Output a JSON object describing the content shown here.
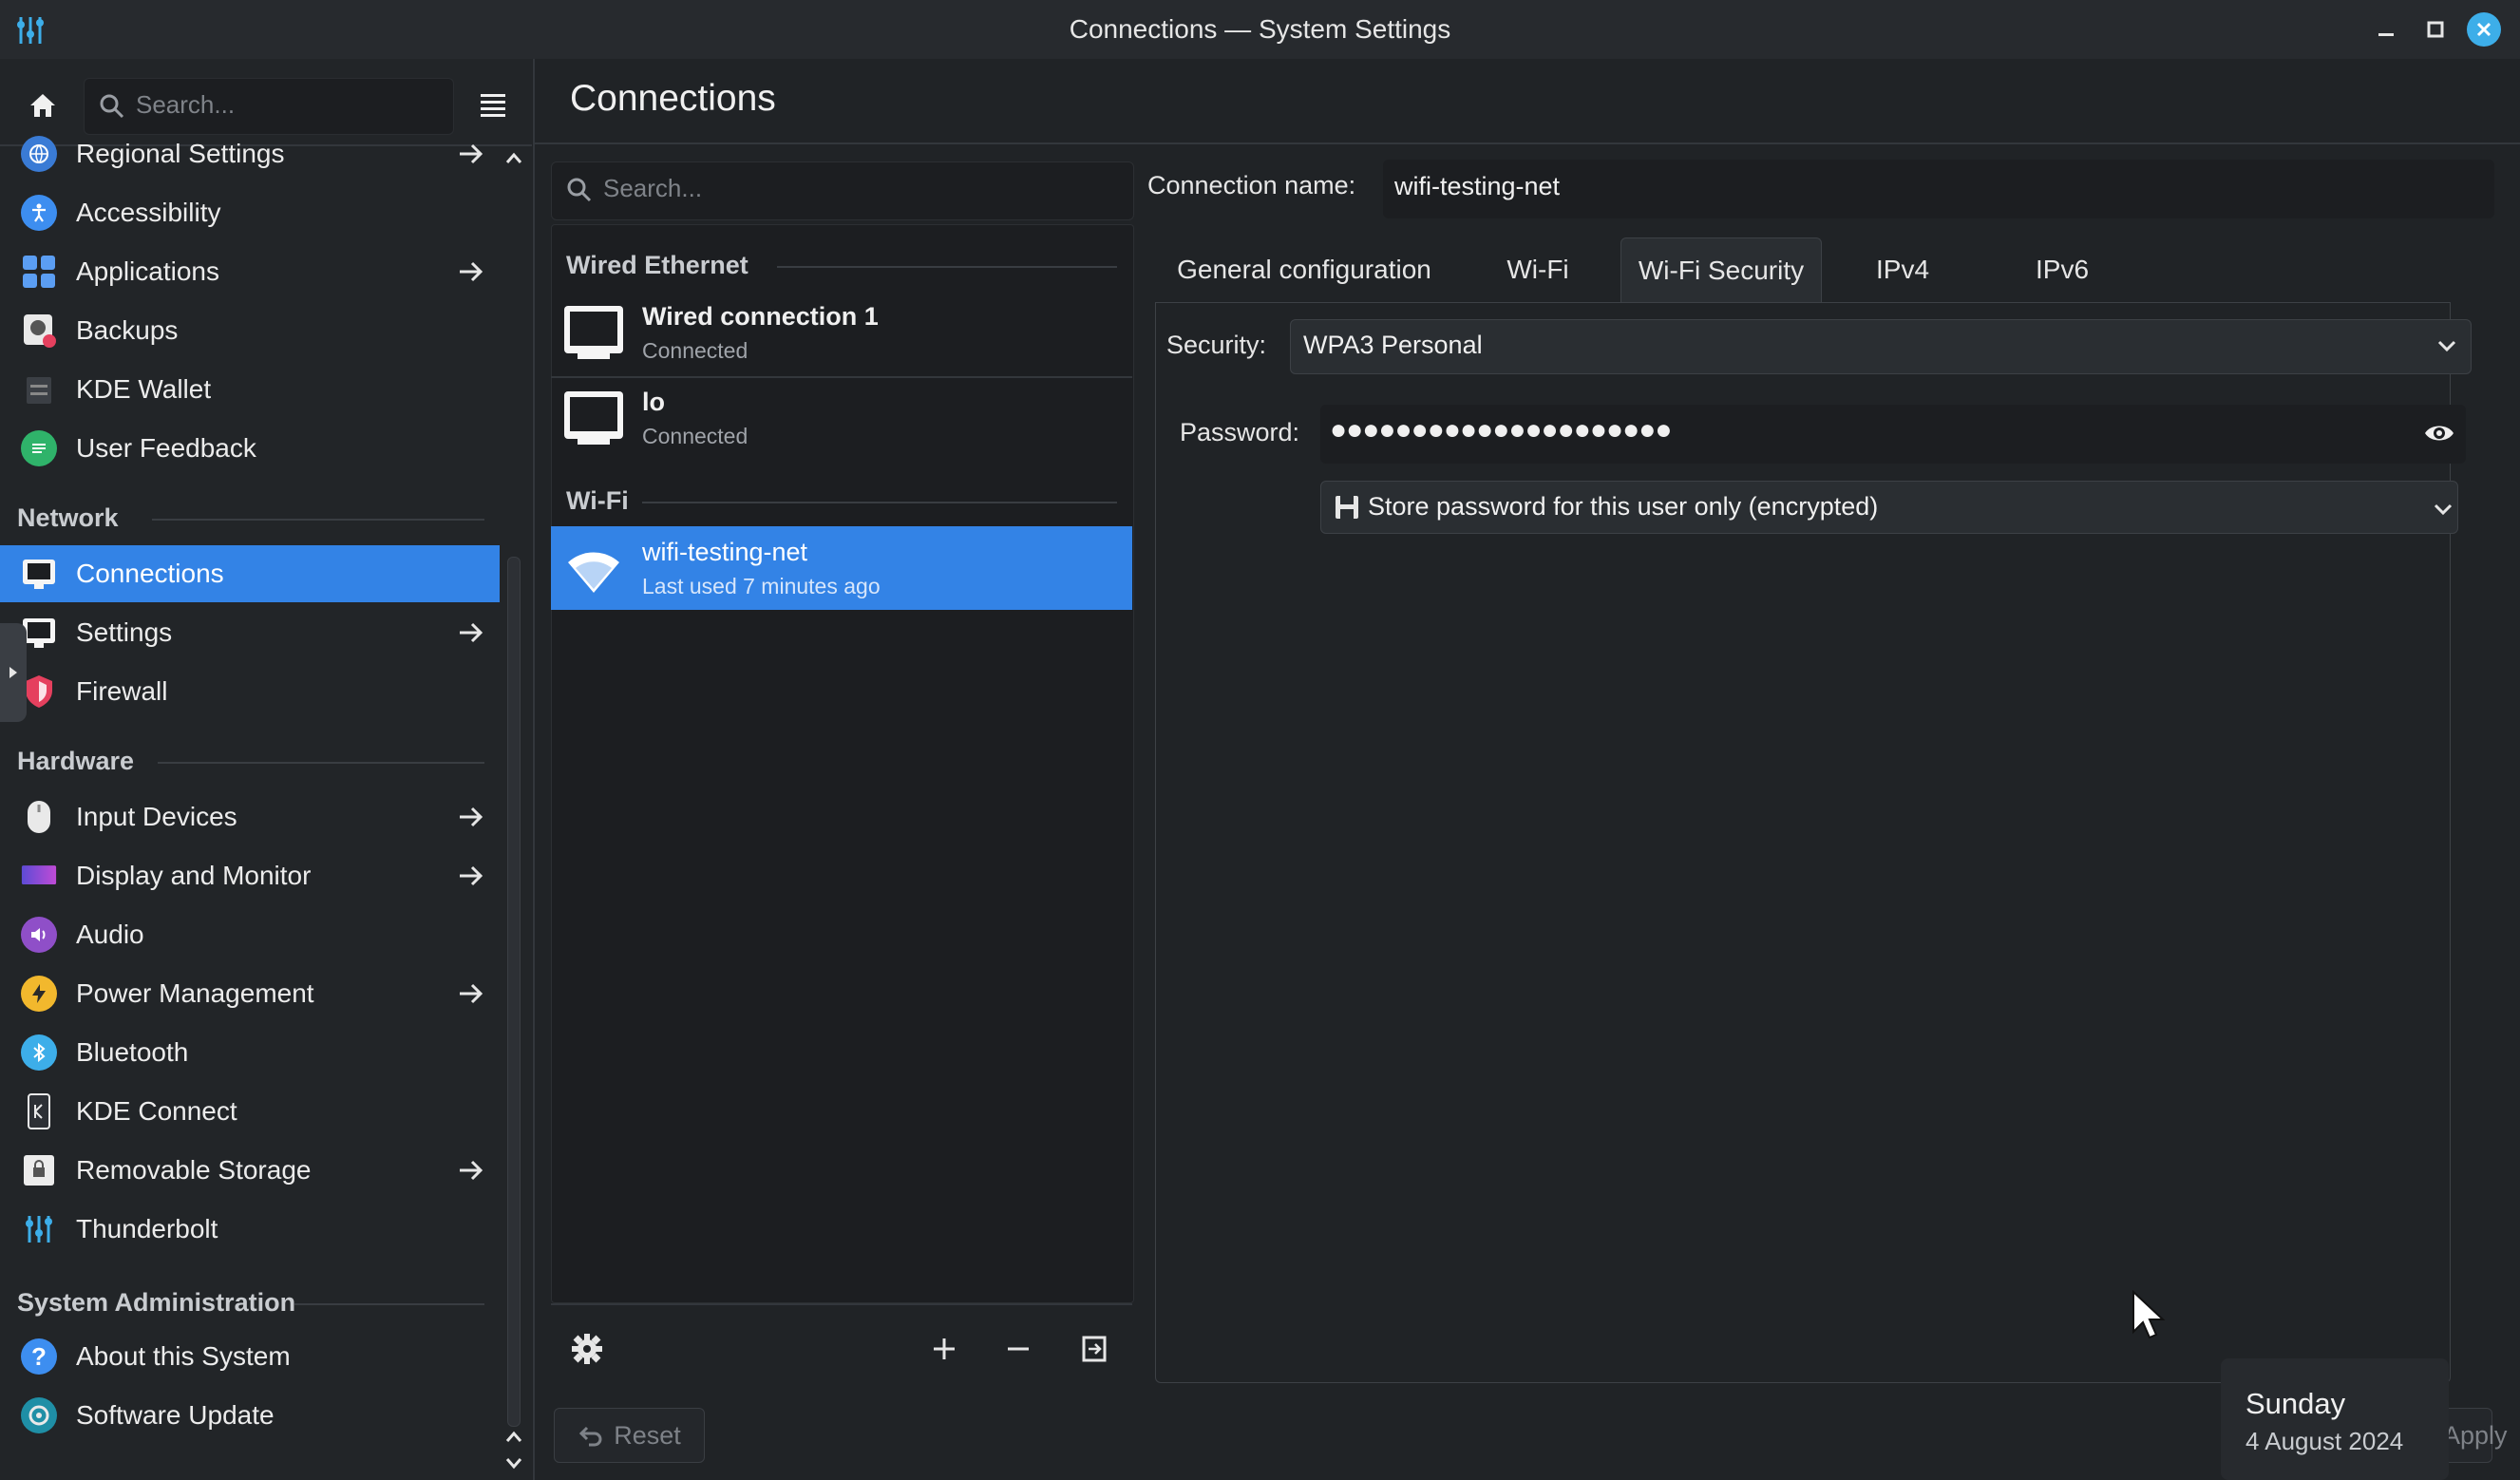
{
  "window": {
    "title": "Connections — System Settings"
  },
  "sidebar": {
    "search_placeholder": "Search...",
    "items_top": [
      {
        "label": "Regional Settings",
        "icon": "globe-icon",
        "arrow": true
      },
      {
        "label": "Accessibility",
        "icon": "accessibility-icon",
        "arrow": false
      },
      {
        "label": "Applications",
        "icon": "applications-icon",
        "arrow": true
      },
      {
        "label": "Backups",
        "icon": "backups-icon",
        "arrow": false
      },
      {
        "label": "KDE Wallet",
        "icon": "wallet-icon",
        "arrow": false
      },
      {
        "label": "User Feedback",
        "icon": "feedback-icon",
        "arrow": false
      }
    ],
    "sections": {
      "network": "Network",
      "hardware": "Hardware",
      "sysadmin": "System Administration"
    },
    "network_items": [
      {
        "label": "Connections",
        "icon": "network-connections-icon",
        "arrow": false,
        "active": true
      },
      {
        "label": "Settings",
        "icon": "network-settings-icon",
        "arrow": true
      },
      {
        "label": "Firewall",
        "icon": "firewall-icon",
        "arrow": false
      }
    ],
    "hardware_items": [
      {
        "label": "Input Devices",
        "icon": "mouse-icon",
        "arrow": true
      },
      {
        "label": "Display and Monitor",
        "icon": "display-icon",
        "arrow": true
      },
      {
        "label": "Audio",
        "icon": "audio-icon",
        "arrow": false
      },
      {
        "label": "Power Management",
        "icon": "power-icon",
        "arrow": true
      },
      {
        "label": "Bluetooth",
        "icon": "bluetooth-icon",
        "arrow": false
      },
      {
        "label": "KDE Connect",
        "icon": "kde-connect-icon",
        "arrow": false
      },
      {
        "label": "Removable Storage",
        "icon": "removable-storage-icon",
        "arrow": true
      },
      {
        "label": "Thunderbolt",
        "icon": "thunderbolt-icon",
        "arrow": false
      }
    ],
    "sysadmin_items": [
      {
        "label": "About this System",
        "icon": "about-icon",
        "arrow": false
      },
      {
        "label": "Software Update",
        "icon": "software-update-icon",
        "arrow": false
      }
    ]
  },
  "content": {
    "title": "Connections",
    "search_placeholder": "Search...",
    "list": {
      "wired_header": "Wired Ethernet",
      "wifi_header": "Wi-Fi",
      "wired": [
        {
          "name": "Wired connection 1",
          "status": "Connected"
        },
        {
          "name": "lo",
          "status": "Connected"
        }
      ],
      "wifi": [
        {
          "name": "wifi-testing-net",
          "status": "Last used 7 minutes ago",
          "selected": true
        }
      ]
    },
    "reset_label": "Reset",
    "apply_label": "Apply",
    "details": {
      "connection_name_label": "Connection name:",
      "connection_name": "wifi-testing-net",
      "tabs": [
        "General configuration",
        "Wi-Fi",
        "Wi-Fi Security",
        "IPv4",
        "IPv6"
      ],
      "active_tab": "Wi-Fi Security",
      "security_label": "Security:",
      "security_value": "WPA3 Personal",
      "password_label": "Password:",
      "password_masked": "●●●●●●●●●●●●●●●●●●●●●",
      "store_option": "Store password for this user only (encrypted)"
    }
  },
  "date_popup": {
    "day": "Sunday",
    "date": "4 August 2024"
  },
  "colors": {
    "accent": "#3383e6",
    "background": "#202326",
    "close": "#3daee9"
  }
}
